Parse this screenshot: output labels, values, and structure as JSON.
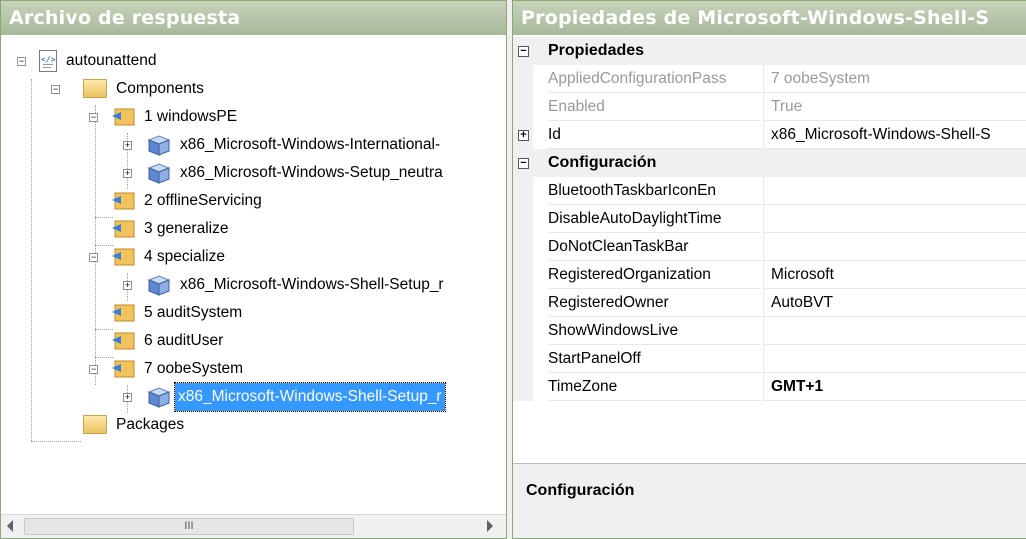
{
  "left_pane": {
    "title": "Archivo de respuesta",
    "tree": {
      "root": "autounattend",
      "components": "Components",
      "pass_windowsPE": "1 windowsPE",
      "item_intl": "x86_Microsoft-Windows-International-",
      "item_setup_neutral": "x86_Microsoft-Windows-Setup_neutra",
      "pass_offline": "2 offlineServicing",
      "pass_generalize": "3 generalize",
      "pass_specialize": "4 specialize",
      "item_shell_specialize": "x86_Microsoft-Windows-Shell-Setup_r",
      "pass_auditSystem": "5 auditSystem",
      "pass_auditUser": "6 auditUser",
      "pass_oobe": "7 oobeSystem",
      "item_shell_oobe": "x86_Microsoft-Windows-Shell-Setup_r",
      "packages": "Packages"
    },
    "scrollbar_grip": "III"
  },
  "right_pane": {
    "title": "Propiedades de Microsoft-Windows-Shell-S",
    "cat_propiedades": "Propiedades",
    "applied_name": "AppliedConfigurationPass",
    "applied_value": "7 oobeSystem",
    "enabled_name": "Enabled",
    "enabled_value": "True",
    "id_name": "Id",
    "id_value": "x86_Microsoft-Windows-Shell-S",
    "cat_config": "Configuración",
    "settings": [
      {
        "name": "BluetoothTaskbarIconEn",
        "value": ""
      },
      {
        "name": "DisableAutoDaylightTime",
        "value": ""
      },
      {
        "name": "DoNotCleanTaskBar",
        "value": ""
      },
      {
        "name": "RegisteredOrganization",
        "value": "Microsoft"
      },
      {
        "name": "RegisteredOwner",
        "value": "AutoBVT"
      },
      {
        "name": "ShowWindowsLive",
        "value": ""
      },
      {
        "name": "StartPanelOff",
        "value": ""
      },
      {
        "name": "TimeZone",
        "value": "GMT+1"
      }
    ],
    "description_title": "Configuración"
  },
  "colors": {
    "title_gradient_top": "#c7d3bc",
    "title_gradient_bottom": "#a7b99a",
    "selection": "#3399ff",
    "pane_border": "#8aa872"
  }
}
